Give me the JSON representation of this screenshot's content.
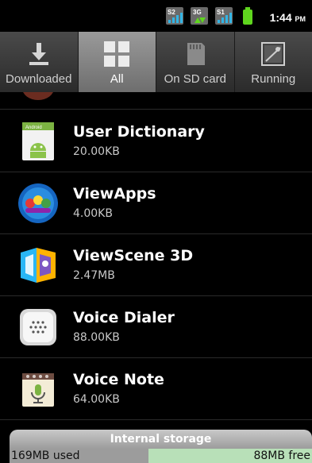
{
  "status_bar": {
    "signal_1_label": "S2",
    "data_label": "3G",
    "signal_2_label": "S1",
    "time": "1:44",
    "ampm": "PM"
  },
  "tabs": [
    {
      "label": "Downloaded",
      "icon": "download-icon",
      "active": false
    },
    {
      "label": "All",
      "icon": "grid-icon",
      "active": true
    },
    {
      "label": "On SD card",
      "icon": "sdcard-icon",
      "active": false
    },
    {
      "label": "Running",
      "icon": "running-icon",
      "active": false
    }
  ],
  "apps": [
    {
      "name": "User Dictionary",
      "size": "20.00KB",
      "icon": "android-dictionary-icon"
    },
    {
      "name": "ViewApps",
      "size": "4.00KB",
      "icon": "viewapps-icon"
    },
    {
      "name": "ViewScene 3D",
      "size": "2.47MB",
      "icon": "viewscene-icon"
    },
    {
      "name": "Voice Dialer",
      "size": "88.00KB",
      "icon": "voice-dialer-icon"
    },
    {
      "name": "Voice Note",
      "size": "64.00KB",
      "icon": "voice-note-icon"
    }
  ],
  "storage": {
    "title": "Internal storage",
    "used_label": "169MB used",
    "free_label": "88MB free",
    "used_fraction": 0.46
  },
  "colors": {
    "free_bar": "#b8e0b8",
    "used_bar": "#9c9c9c",
    "battery": "#5fd61e",
    "signal": "#33b5e5"
  }
}
